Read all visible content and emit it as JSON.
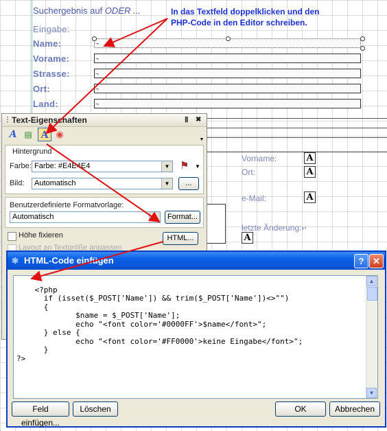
{
  "form": {
    "title_prefix": "Suchergebnis auf",
    "title_emph": "ODER ...",
    "section_label": "Eingabe:",
    "fields": [
      {
        "label": "Name:",
        "placeholder_glyph": "¬"
      },
      {
        "label": "Vorame:",
        "placeholder_glyph": "¬"
      },
      {
        "label": "Strasse:",
        "placeholder_glyph": "¬"
      },
      {
        "label": "Ort:",
        "placeholder_glyph": "¬"
      },
      {
        "label": "Land:",
        "placeholder_glyph": "¬"
      }
    ],
    "right_labels": {
      "vorname": "Vorname:",
      "ort": "Ort:",
      "email": "e-Mail:",
      "letzte_aenderung": "letzte Änderung:"
    }
  },
  "annotation": {
    "line1": "In das Textfeld doppelklicken und den",
    "line2": "PHP-Code in den Editor schreiben."
  },
  "properties_panel": {
    "title": "Text-Eigenschaften",
    "pin_glyph": "Ⅱ",
    "close_glyph": "✖",
    "hintergrund": "Hintergrund",
    "farbe_label": "Farbe:",
    "farbe_value": "Farbe: #E4E4E4",
    "bild_label": "Bild:",
    "bild_value": "Automatisch",
    "bild_button": "...",
    "format_group": "Benutzerdefinierte Formatvorlage:",
    "format_value": "Automatisch",
    "format_button": "Format...",
    "hoehe_fixieren": "Höhe fixieren",
    "layout_text": "Layout an Textgröße anpassen",
    "html_button": "HTML..."
  },
  "dialog": {
    "title": "HTML-Code einfügen",
    "help_glyph": "?",
    "close_glyph": "✕",
    "code": "<?php\n      if (isset($_POST['Name']) && trim($_POST['Name'])<>\"\")\n      {\n             $name = $_POST['Name'];\n             echo \"<font color='#0000FF'>$name</font>\";\n      } else {\n             echo \"<font color='#FF0000'>keine Eingabe</font>\";\n      }\n?>",
    "btn_feld": "Feld einfügen...",
    "btn_loeschen": "Löschen",
    "btn_ok": "OK",
    "btn_abbrechen": "Abbrechen"
  },
  "colors": {
    "arrow": "#e01010",
    "annotation": "#1c2fd0",
    "titlebar": "#0a5fe4"
  }
}
